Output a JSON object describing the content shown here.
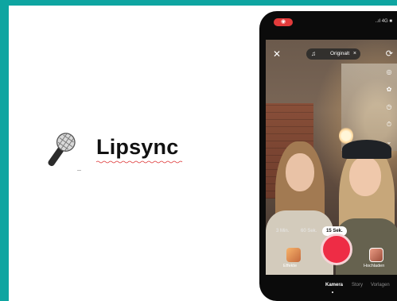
{
  "slide": {
    "title": "Lipsync"
  },
  "phone": {
    "status": {
      "rec_label": "◉",
      "right_text": "..ıl 4G ■"
    },
    "top": {
      "close_icon": "close-icon",
      "sound_label": "Originalt",
      "sound_close": "×",
      "flip_icon": "flip-camera-icon"
    },
    "tools": [
      {
        "name": "filters-icon",
        "glyph": "◎"
      },
      {
        "name": "beauty-icon",
        "glyph": "✿"
      },
      {
        "name": "speed-icon",
        "glyph": "◷"
      },
      {
        "name": "timer-icon",
        "glyph": "⏱"
      },
      {
        "name": "more-icon",
        "glyph": "⌄"
      }
    ],
    "durations": [
      {
        "label": "3 Min.",
        "active": false
      },
      {
        "label": "60 Sek.",
        "active": false
      },
      {
        "label": "15 Sek.",
        "active": true
      }
    ],
    "effects_label": "Effekte",
    "upload_label": "Hochladen",
    "bottom_tabs": [
      {
        "label": "Kamera",
        "active": true
      },
      {
        "label": "Story",
        "active": false
      },
      {
        "label": "Vorlagen",
        "active": false
      }
    ],
    "colors": {
      "record": "#ee2c45",
      "rec_pill": "#e23b3b"
    }
  }
}
